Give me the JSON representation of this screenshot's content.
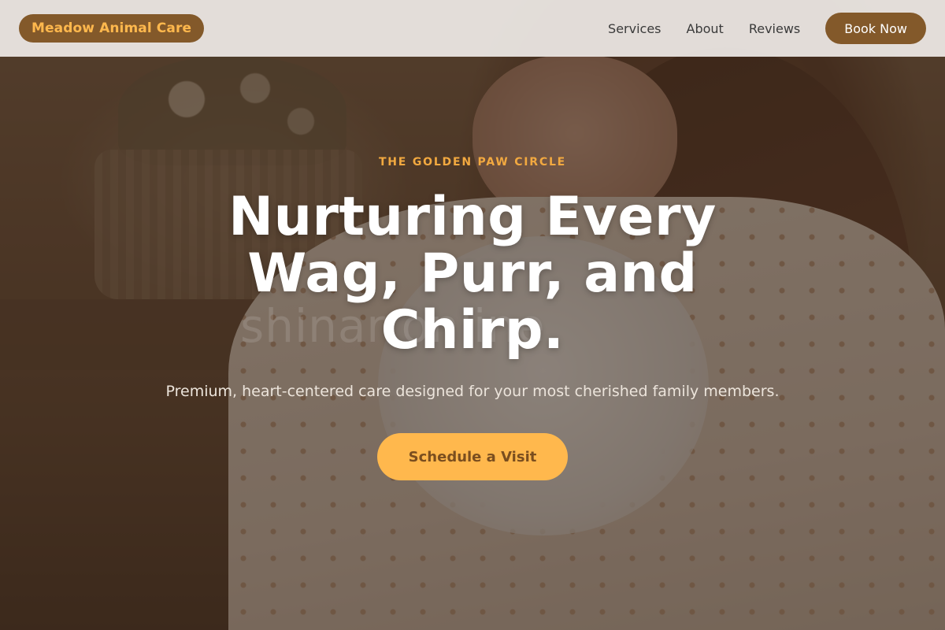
{
  "header": {
    "brand": "Meadow Animal Care",
    "nav": [
      {
        "label": "Services"
      },
      {
        "label": "About"
      },
      {
        "label": "Reviews"
      }
    ],
    "cta_label": "Book Now"
  },
  "hero": {
    "eyebrow": "THE GOLDEN PAW CIRCLE",
    "headline": "Nurturing Every Wag, Purr, and Chirp.",
    "subtitle": "Premium, heart-centered care designed for your most cherished family members.",
    "cta_label": "Schedule a Visit",
    "watermark": "shinar online",
    "image_subject": "woman-holding-white-rabbit-photo"
  },
  "colors": {
    "brand_brown": "#83592a",
    "accent_amber": "#ffb84d",
    "header_bg": "#eeeae6"
  }
}
